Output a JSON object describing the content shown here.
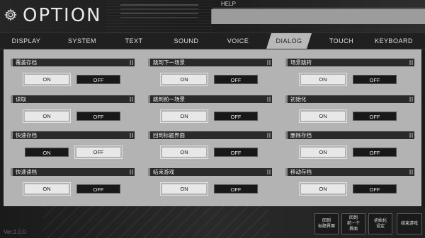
{
  "header": {
    "title": "OPTION",
    "help_label": "HELP",
    "help_text": ""
  },
  "tabs": [
    {
      "label": "DISPLAY",
      "active": false
    },
    {
      "label": "SYSTEM",
      "active": false
    },
    {
      "label": "TEXT",
      "active": false
    },
    {
      "label": "SOUND",
      "active": false
    },
    {
      "label": "VOICE",
      "active": false
    },
    {
      "label": "DIALOG",
      "active": true
    },
    {
      "label": "TOUCH",
      "active": false
    },
    {
      "label": "KEYBOARD",
      "active": false
    }
  ],
  "options": [
    {
      "label": "覆盖存档",
      "on": "ON",
      "off": "OFF",
      "selected": "on"
    },
    {
      "label": "跳到下一场景",
      "on": "ON",
      "off": "OFF",
      "selected": "on"
    },
    {
      "label": "场景跳转",
      "on": "ON",
      "off": "OFF",
      "selected": "on"
    },
    {
      "label": "读取",
      "on": "ON",
      "off": "OFF",
      "selected": "on"
    },
    {
      "label": "跳到前一场景",
      "on": "ON",
      "off": "OFF",
      "selected": "on"
    },
    {
      "label": "初始化",
      "on": "ON",
      "off": "OFF",
      "selected": "on"
    },
    {
      "label": "快速存档",
      "on": "ON",
      "off": "OFF",
      "selected": "off"
    },
    {
      "label": "回到标题界面",
      "on": "ON",
      "off": "OFF",
      "selected": "on"
    },
    {
      "label": "删除存档",
      "on": "ON",
      "off": "OFF",
      "selected": "on"
    },
    {
      "label": "快速读档",
      "on": "ON",
      "off": "OFF",
      "selected": "on"
    },
    {
      "label": "结束游戏",
      "on": "ON",
      "off": "OFF",
      "selected": "on"
    },
    {
      "label": "移动存档",
      "on": "ON",
      "off": "OFF",
      "selected": "on"
    }
  ],
  "footer": {
    "version": "Ver.1.0.0",
    "buttons": [
      {
        "label": "回到\n标题界面"
      },
      {
        "label": "回到\n前一个\n界面"
      },
      {
        "label": "初始化\n设定"
      },
      {
        "label": "结束游戏"
      }
    ]
  },
  "colors": {
    "panel_bg": "#b3b3b3",
    "label_bg": "#2a2a2a",
    "on_selected": "#e8e8e8",
    "off_bg": "#181818",
    "help_box": "#9c9c9c"
  }
}
